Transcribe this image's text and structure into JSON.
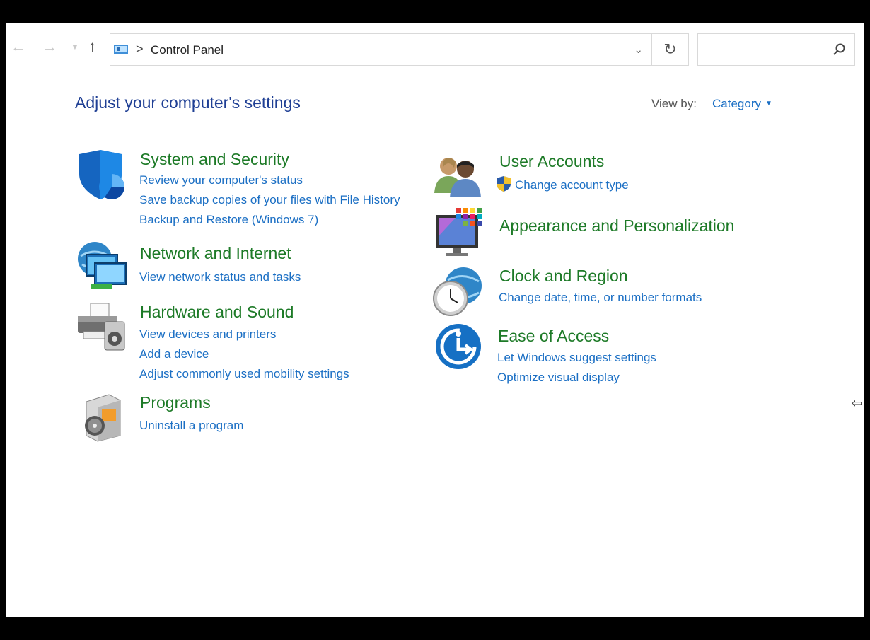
{
  "nav": {
    "back_icon": "arrow-left-icon",
    "forward_icon": "arrow-right-icon",
    "recent_icon": "chevron-down-icon",
    "up_icon": "arrow-up-icon"
  },
  "address_bar": {
    "breadcrumb": "Control Panel",
    "separator": ">",
    "dropdown_icon": "chevron-down-icon",
    "refresh_icon": "refresh-icon"
  },
  "search": {
    "value": "",
    "icon": "search-icon"
  },
  "header": {
    "title": "Adjust your computer's settings",
    "view_by_label": "View by:",
    "view_by_value": "Category"
  },
  "categories": {
    "system_security": {
      "heading": "System and Security",
      "links": [
        "Review your computer's status",
        "Save backup copies of your files with File History",
        "Backup and Restore (Windows 7)"
      ]
    },
    "network": {
      "heading": "Network and Internet",
      "links": [
        "View network status and tasks"
      ]
    },
    "hardware": {
      "heading": "Hardware and Sound",
      "links": [
        "View devices and printers",
        "Add a device",
        "Adjust commonly used mobility settings"
      ]
    },
    "programs": {
      "heading": "Programs",
      "links": [
        "Uninstall a program"
      ]
    },
    "user_accounts": {
      "heading": "User Accounts",
      "links": [
        "Change account type"
      ]
    },
    "appearance": {
      "heading": "Appearance and Personalization",
      "links": []
    },
    "clock": {
      "heading": "Clock and Region",
      "links": [
        "Change date, time, or number formats"
      ]
    },
    "ease": {
      "heading": "Ease of Access",
      "links": [
        "Let Windows suggest settings",
        "Optimize visual display"
      ]
    }
  },
  "colors": {
    "heading_green": "#1d7a27",
    "link_blue": "#1b6fc4",
    "title_blue": "#1f3f94"
  }
}
